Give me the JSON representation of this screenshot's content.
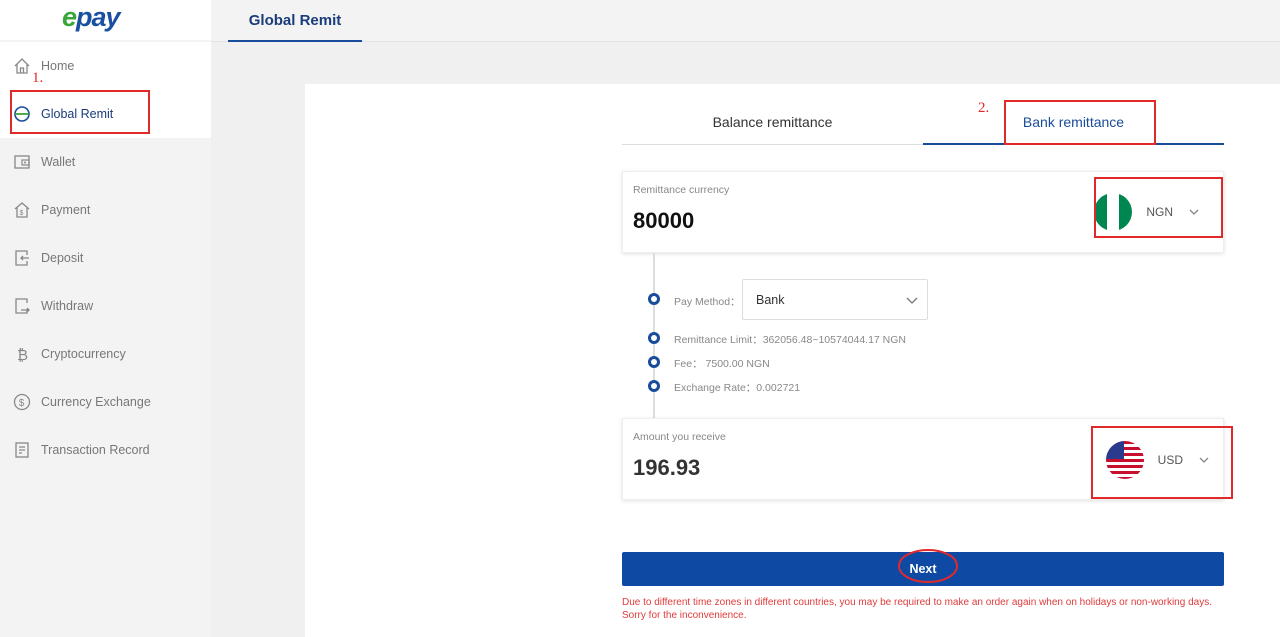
{
  "app": {
    "logo_prefix": "e",
    "logo_rest": "pay"
  },
  "header": {
    "active_tab": "Global Remit"
  },
  "sidebar": {
    "items": [
      {
        "label": "Home",
        "icon": "home-icon"
      },
      {
        "label": "Global Remit",
        "icon": "globe-icon"
      },
      {
        "label": "Wallet",
        "icon": "wallet-icon"
      },
      {
        "label": "Payment",
        "icon": "payment-icon"
      },
      {
        "label": "Deposit",
        "icon": "deposit-icon"
      },
      {
        "label": "Withdraw",
        "icon": "withdraw-icon"
      },
      {
        "label": "Cryptocurrency",
        "icon": "bitcoin-icon"
      },
      {
        "label": "Currency Exchange",
        "icon": "dollar-circle-icon"
      },
      {
        "label": "Transaction Record",
        "icon": "document-icon"
      }
    ]
  },
  "annotations": {
    "step1": "1.",
    "step2": "2."
  },
  "remit": {
    "tabs": [
      "Balance remittance",
      "Bank remittance"
    ],
    "send": {
      "label": "Remittance currency",
      "amount": "80000",
      "currency": "NGN"
    },
    "pay_method_label": "Pay Method：",
    "pay_method_value": "Bank",
    "limit": "Remittance Limit：362056.48~10574044.17 NGN",
    "fee": "Fee： 7500.00 NGN",
    "rate": "Exchange Rate：0.002721",
    "receive": {
      "label": "Amount you receive",
      "amount": "196.93",
      "currency": "USD"
    },
    "next_label": "Next",
    "note": "Due to different time zones in different countries, you may be required to make an order again when on holidays or non-working days. Sorry for the inconvenience."
  },
  "colors": {
    "accent": "#0e4aa3",
    "annotation": "#e0292b",
    "note": "#e03b3b",
    "nigeria_green": "#008751"
  }
}
